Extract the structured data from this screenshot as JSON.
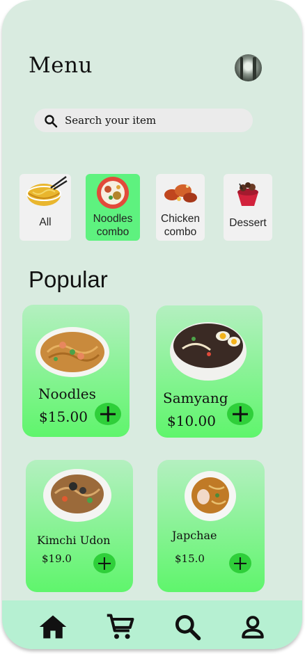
{
  "header": {
    "title": "Menu"
  },
  "search": {
    "placeholder": "Search your item"
  },
  "categories": [
    {
      "label": "All",
      "icon": "noodle-bowl-icon"
    },
    {
      "label": "Noodles\ncombo",
      "icon": "noodle-combo-icon"
    },
    {
      "label": "Chicken\ncombo",
      "icon": "chicken-icon"
    },
    {
      "label": "Dessert",
      "icon": "dessert-icon"
    }
  ],
  "popular": {
    "title": "Popular",
    "items": [
      {
        "name": "Noodles",
        "price": "$15.00"
      },
      {
        "name": "Samyang",
        "price": "$10.00"
      },
      {
        "name": "Kimchi Udon",
        "price": "$19.0"
      },
      {
        "name": "Japchae",
        "price": "$15.0"
      }
    ]
  },
  "nav": {
    "items": [
      "home-icon",
      "cart-icon",
      "search-icon",
      "profile-icon"
    ]
  },
  "colors": {
    "background": "#d9ebe0",
    "accent": "#5ef27f",
    "add_button": "#2fcf3a",
    "nav_bar": "#b6f0d2"
  }
}
